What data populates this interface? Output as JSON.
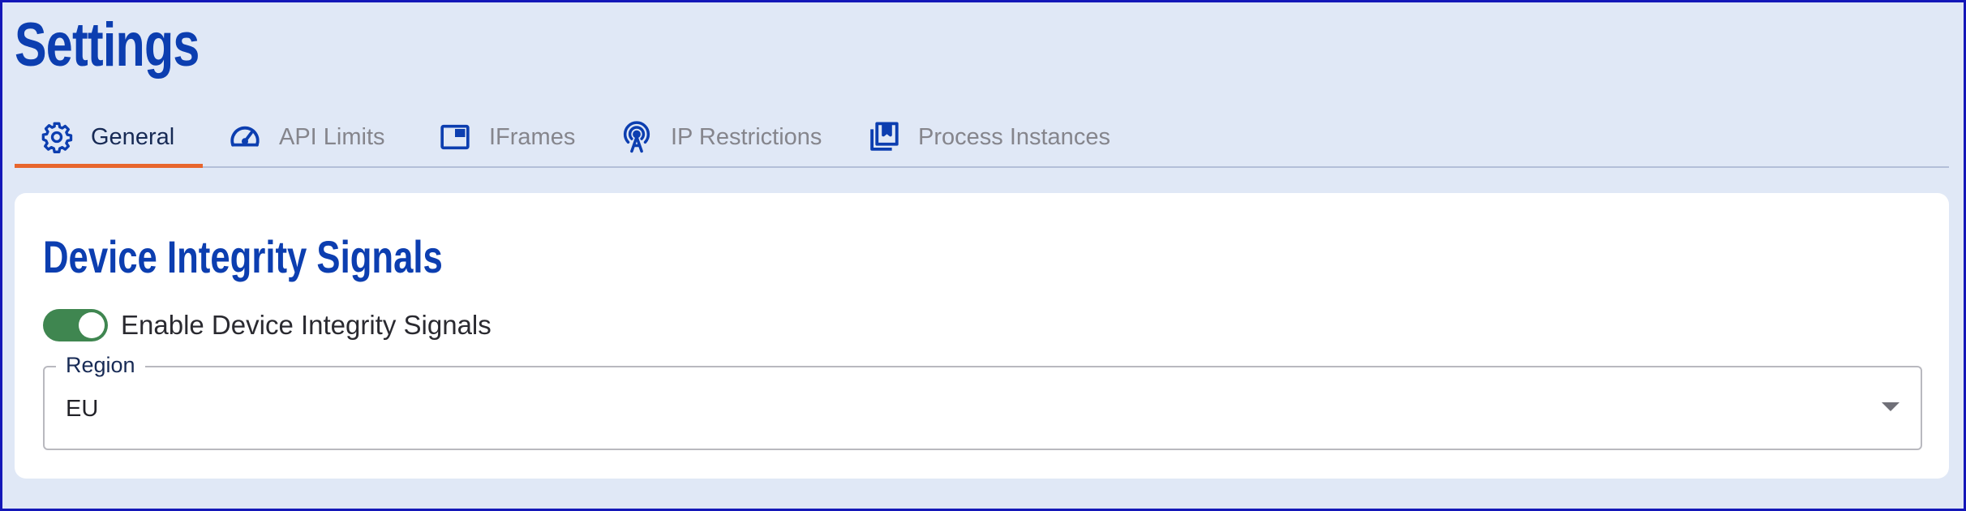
{
  "page": {
    "title": "Settings"
  },
  "tabs": [
    {
      "label": "General",
      "icon": "gear-icon",
      "active": true
    },
    {
      "label": "API Limits",
      "icon": "speedometer-icon",
      "active": false
    },
    {
      "label": "IFrames",
      "icon": "iframe-window-icon",
      "active": false
    },
    {
      "label": "IP Restrictions",
      "icon": "broadcast-tower-icon",
      "active": false
    },
    {
      "label": "Process Instances",
      "icon": "bookmark-stack-icon",
      "active": false
    }
  ],
  "section": {
    "title": "Device Integrity Signals",
    "toggle": {
      "label": "Enable Device Integrity Signals",
      "checked": true
    },
    "region": {
      "label": "Region",
      "value": "EU"
    }
  },
  "colors": {
    "page_background": "#e0e8f6",
    "frame_border": "#1417b8",
    "title_blue": "#0c3eb0",
    "tab_active_text": "#172a55",
    "tab_inactive_text": "#85858c",
    "tab_underline": "#e8662d",
    "toggle_on": "#3f8650",
    "card_background": "#ffffff"
  }
}
